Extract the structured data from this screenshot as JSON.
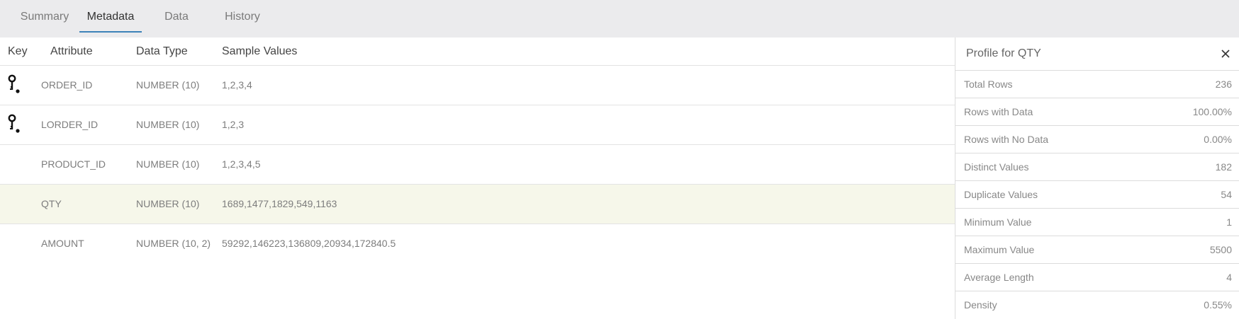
{
  "tabs": [
    {
      "label": "Summary",
      "active": false
    },
    {
      "label": "Metadata",
      "active": true
    },
    {
      "label": "Data",
      "active": false
    },
    {
      "label": "History",
      "active": false
    }
  ],
  "table": {
    "headers": {
      "key": "Key",
      "attribute": "Attribute",
      "data_type": "Data Type",
      "sample_values": "Sample Values"
    },
    "rows": [
      {
        "is_key": true,
        "attribute": "ORDER_ID",
        "data_type": "NUMBER (10)",
        "sample_values": "1,2,3,4"
      },
      {
        "is_key": true,
        "attribute": "LORDER_ID",
        "data_type": "NUMBER (10)",
        "sample_values": "1,2,3"
      },
      {
        "is_key": false,
        "attribute": "PRODUCT_ID",
        "data_type": "NUMBER (10)",
        "sample_values": "1,2,3,4,5"
      },
      {
        "is_key": false,
        "attribute": "QTY",
        "data_type": "NUMBER (10)",
        "sample_values": "1689,1477,1829,549,1163",
        "selected": true
      },
      {
        "is_key": false,
        "attribute": "AMOUNT",
        "data_type": "NUMBER (10, 2)",
        "sample_values": "59292,146223,136809,20934,172840.5"
      }
    ],
    "selected_row_color": "#f6f7ea"
  },
  "profile": {
    "title": "Profile for QTY",
    "close_icon": "close-icon",
    "stats": [
      {
        "label": "Total Rows",
        "value": "236"
      },
      {
        "label": "Rows with Data",
        "value": "100.00%"
      },
      {
        "label": "Rows with No Data",
        "value": "0.00%"
      },
      {
        "label": "Distinct Values",
        "value": "182"
      },
      {
        "label": "Duplicate Values",
        "value": "54"
      },
      {
        "label": "Minimum Value",
        "value": "1"
      },
      {
        "label": "Maximum Value",
        "value": "5500"
      },
      {
        "label": "Average Length",
        "value": "4"
      },
      {
        "label": "Density",
        "value": "0.55%"
      }
    ]
  },
  "colors": {
    "active_tab_underline": "#3d82b8",
    "tabbar_background": "#ebebed"
  }
}
